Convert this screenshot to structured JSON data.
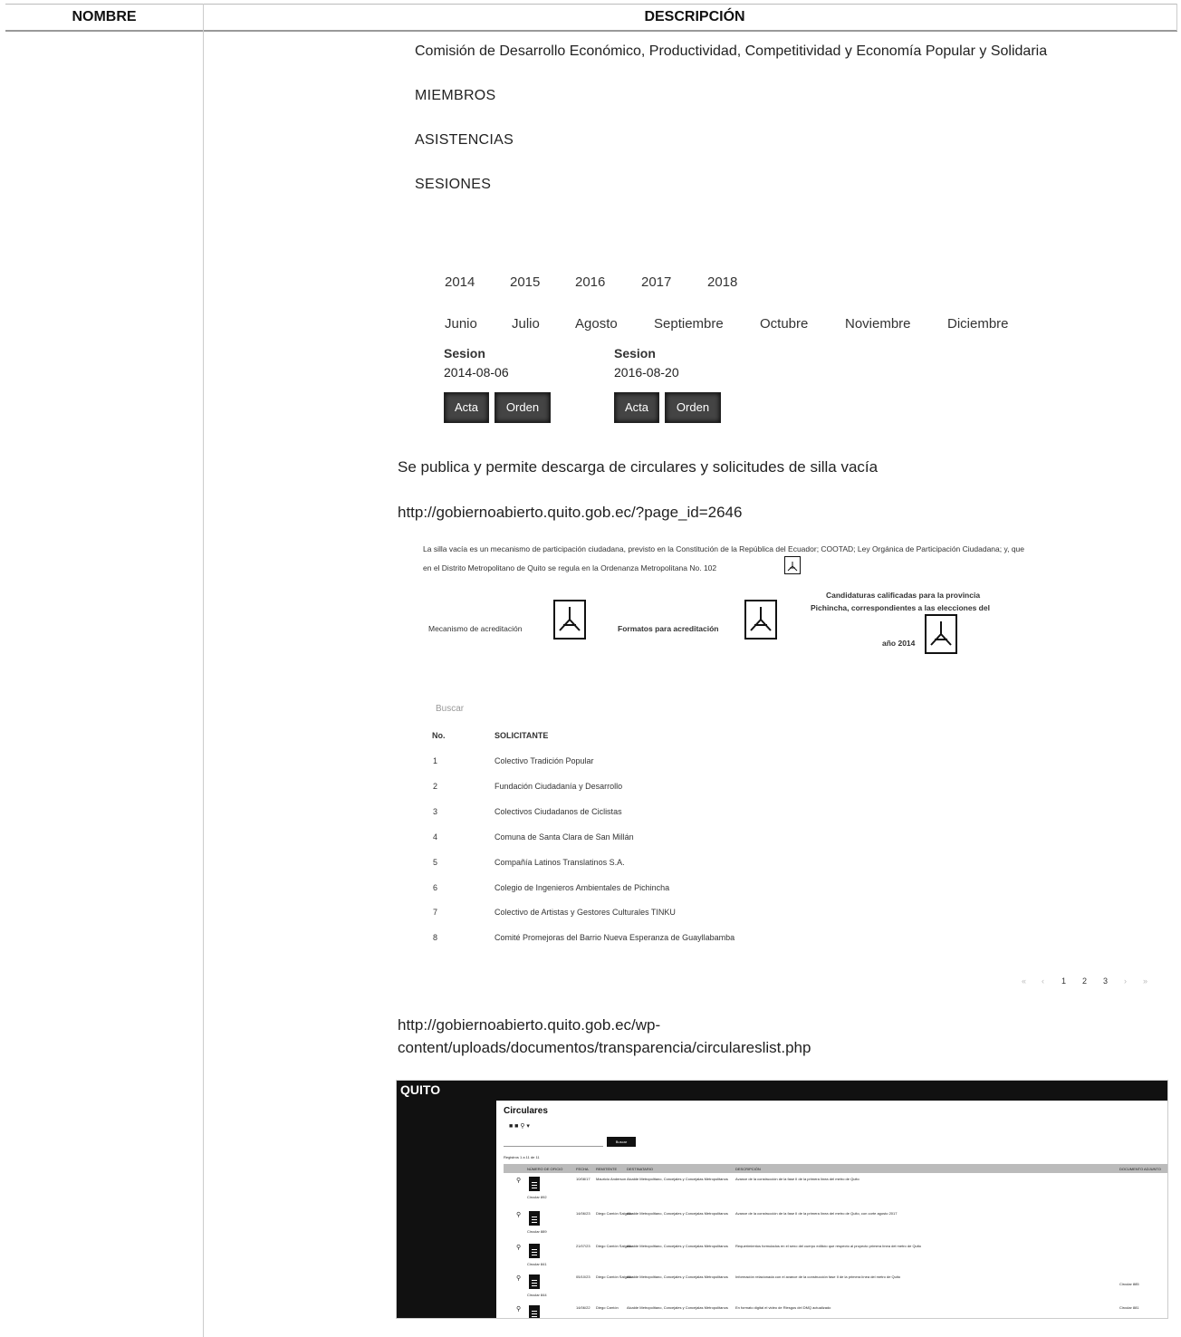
{
  "table": {
    "col_nombre": "NOMBRE",
    "col_descripcion": "DESCRIPCIÓN"
  },
  "commission": "Comisión de Desarrollo Económico, Productividad, Competitividad y Economía Popular y Solidaria",
  "sections": [
    "MIEMBROS",
    "ASISTENCIAS",
    "SESIONES"
  ],
  "years": [
    "2014",
    "2015",
    "2016",
    "2017",
    "2018"
  ],
  "months": [
    "Junio",
    "Julio",
    "Agosto",
    "Septiembre",
    "Octubre",
    "Noviembre",
    "Diciembre"
  ],
  "sessions": [
    {
      "label": "Sesion",
      "date": "2014-08-06",
      "acta": "Acta",
      "orden": "Orden"
    },
    {
      "label": "Sesion",
      "date": "2016-08-20",
      "acta": "Acta",
      "orden": "Orden"
    }
  ],
  "para1": "Se publica y permite descarga de circulares y solicitudes de silla vacía",
  "url1": "http://gobiernoabierto.quito.gob.ec/?page_id=2646",
  "silla": {
    "line1": "La silla vacía es un mecanismo de participación ciudadana, previsto en la Constitución de la República del Ecuador; COOTAD; Ley Orgánica de Participación Ciudadana; y, que",
    "line2": "en el Distrito Metropolitano de Quito se regula en la Ordenanza Metropolitana No. 102",
    "doc1": "Mecanismo de acreditación",
    "doc2": "Formatos para acreditación",
    "doc3_line1": "Candidaturas calificadas para la provincia",
    "doc3_line2": "Pichincha, correspondientes a las elecciones del",
    "doc3_line3": "año 2014"
  },
  "search_label": "Buscar",
  "solicitantes": {
    "col_no": "No.",
    "col_name": "SOLICITANTE",
    "rows": [
      {
        "no": "1",
        "name": "Colectivo Tradición Popular"
      },
      {
        "no": "2",
        "name": "Fundación Ciudadanía y Desarrollo"
      },
      {
        "no": "3",
        "name": "Colectivos Ciudadanos de Ciclistas"
      },
      {
        "no": "4",
        "name": "Comuna de Santa Clara de San Millán"
      },
      {
        "no": "5",
        "name": "Compañía Latinos Translatinos S.A."
      },
      {
        "no": "6",
        "name": "Colegio de Ingenieros Ambientales de Pichincha"
      },
      {
        "no": "7",
        "name": "Colectivo de Artistas y Gestores Culturales TINKU"
      },
      {
        "no": "8",
        "name": "Comité Promejoras del Barrio Nueva Esperanza de Guayllabamba"
      }
    ]
  },
  "pager": [
    "«",
    "‹",
    "1",
    "2",
    "3",
    "›",
    "»"
  ],
  "url2_line1": "http://gobiernoabierto.quito.gob.ec/wp-",
  "url2_line2": "content/uploads/documentos/transparencia/circulareslist.php",
  "circulares": {
    "logo": "QUITO",
    "title": "Circulares",
    "search_button": "Buscar",
    "records": "Registros 1 a 11 de 11",
    "headers": [
      "NÚMERO DE OFICIO",
      "FECHA",
      "REMITENTE",
      "DESTINATARIO",
      "DESCRIPCIÓN",
      "DOCUMENTO ADJUNTO"
    ],
    "rows": [
      {
        "num": "Circular 892",
        "date": "10/08/17",
        "from": "Mauricio Anderson",
        "to": "Alcalde Metropolitano, Concejales y Concejalas Metropolitanos",
        "desc": "Avance de la construcción de la fase II de la primera línea del metro de Quito",
        "doc": ""
      },
      {
        "num": "Circular 889",
        "date": "14/06/23",
        "from": "Diego Carrión Salgado",
        "to": "Alcalde Metropolitano, Concejales y Concejalas Metropolitanos",
        "desc": "Avance de la construcción de la fase II de la primera línea del metro de Quito, con corte agosto 2017",
        "doc": ""
      },
      {
        "num": "Circular 841",
        "date": "21/07/23",
        "from": "Diego Carrión Salgado",
        "to": "Alcalde Metropolitano, Concejales y Concejalas Metropolitanos",
        "desc": "Requerimientos formulados en el seno del cuerpo edilicio que respecto al proyecto primera línea del metro de Quito",
        "doc": ""
      },
      {
        "num": "Circular 844",
        "date": "05/10/23",
        "from": "Diego Carrión Salgado",
        "to": "Alcalde Metropolitano, Concejales y Concejalas Metropolitanos",
        "desc": "Información relacionada con el avance de la construcción fase II de la primera línea del metro de Quito",
        "doc": "Circular 885"
      },
      {
        "num": "",
        "date": "14/06/22",
        "from": "Diego Carrión",
        "to": "Alcalde Metropolitano, Concejales y Concejalas Metropolitanos",
        "desc": "En formato digital el video de Riesgos del DMQ actualizado",
        "doc": "Circular 881"
      }
    ]
  }
}
